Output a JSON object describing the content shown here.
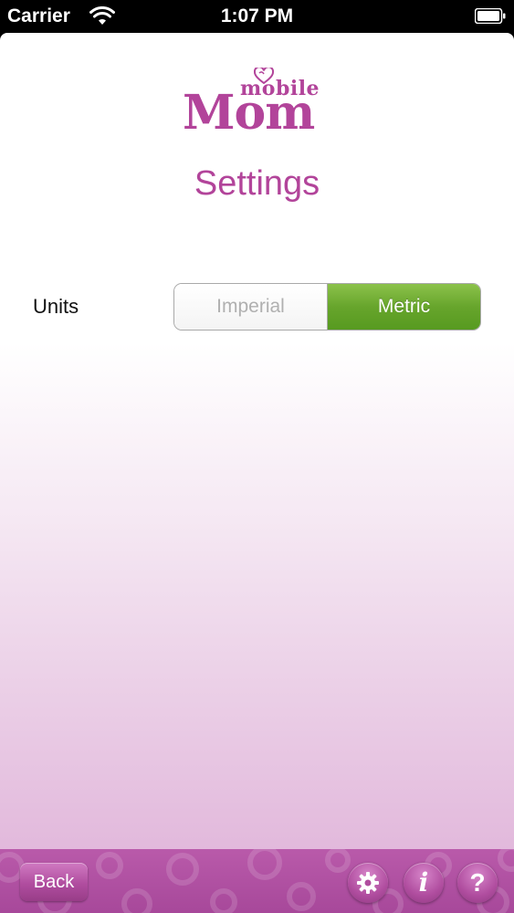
{
  "status_bar": {
    "carrier": "Carrier",
    "time": "1:07 PM",
    "wifi_icon": "wifi-icon",
    "battery_icon": "battery-icon"
  },
  "header": {
    "logo_small": "mobile",
    "logo_large": "Mom",
    "title": "Settings"
  },
  "settings": {
    "units_label": "Units",
    "units_options": [
      "Imperial",
      "Metric"
    ],
    "units_selected": "Metric"
  },
  "toolbar": {
    "back_label": "Back",
    "settings_icon": "gear-icon",
    "info_label": "i",
    "help_label": "?"
  },
  "colors": {
    "brand": "#b2449a",
    "selected_segment": "#67a52c",
    "toolbar": "#b05aa3"
  }
}
